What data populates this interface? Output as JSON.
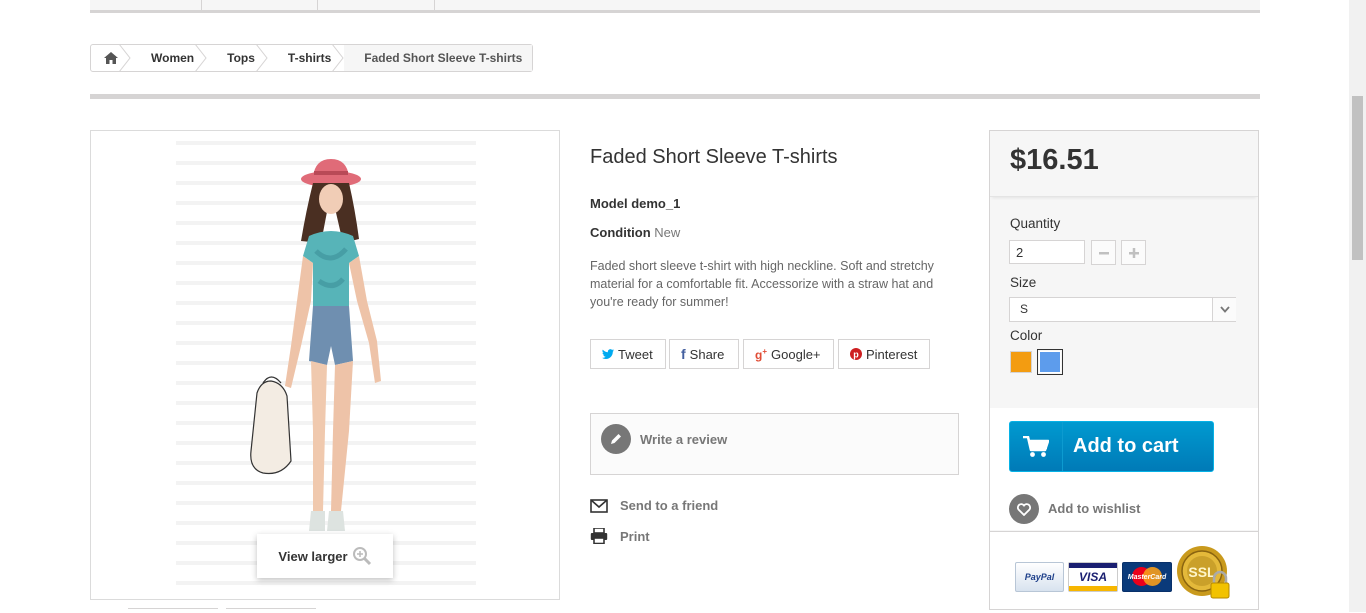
{
  "breadcrumb": {
    "items": [
      "Women",
      "Tops",
      "T-shirts"
    ],
    "current": "Faded Short Sleeve T-shirts"
  },
  "image": {
    "view_larger": "View larger"
  },
  "product": {
    "title": "Faded Short Sleeve T-shirts",
    "model_label": "Model",
    "model_value": "demo_1",
    "condition_label": "Condition",
    "condition_value": "New",
    "description": "Faded short sleeve t-shirt with high neckline. Soft and stretchy material for a comfortable fit. Accessorize with a straw hat and you're ready for summer!"
  },
  "social": {
    "tweet": "Tweet",
    "share": "Share",
    "google": "Google+",
    "pinterest": "Pinterest"
  },
  "review": {
    "write": "Write a review"
  },
  "extras": {
    "send": "Send to a friend",
    "print": "Print"
  },
  "buy": {
    "price": "$16.51",
    "quantity_label": "Quantity",
    "quantity_value": "2",
    "size_label": "Size",
    "size_value": "S",
    "color_label": "Color",
    "colors": [
      "#f39c11",
      "#5d9cec"
    ],
    "add_to_cart": "Add to cart",
    "add_to_wishlist": "Add to wishlist"
  },
  "payment": {
    "paypal": "PayPal",
    "visa": "VISA",
    "mastercard": "MasterCard",
    "ssl": "SSL"
  },
  "colors": {
    "accent": "#0b94d6",
    "border": "#d6d4d4"
  }
}
